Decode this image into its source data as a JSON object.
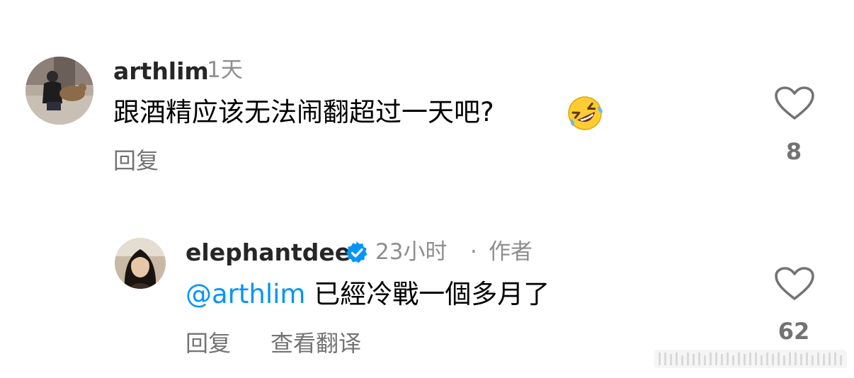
{
  "comments": [
    {
      "username": "arthlim",
      "time": "1天",
      "text": "跟酒精应该无法闹翻超过一天吧?",
      "emoji_icon": "rolling-on-floor-laughing-emoji",
      "reply_label": "回复",
      "like_count": "8"
    },
    {
      "username": "elephantdee",
      "verified": true,
      "time": "23小时",
      "separator": "·",
      "author_label": "作者",
      "mention": "@arthlim",
      "text": "已經冷戰一個多月了",
      "reply_label": "回复",
      "translate_label": "查看翻译",
      "like_count": "62"
    }
  ],
  "colors": {
    "username": "#262626",
    "secondary": "#8e8e8e",
    "mention": "#0095f6",
    "verified": "#0095f6"
  }
}
